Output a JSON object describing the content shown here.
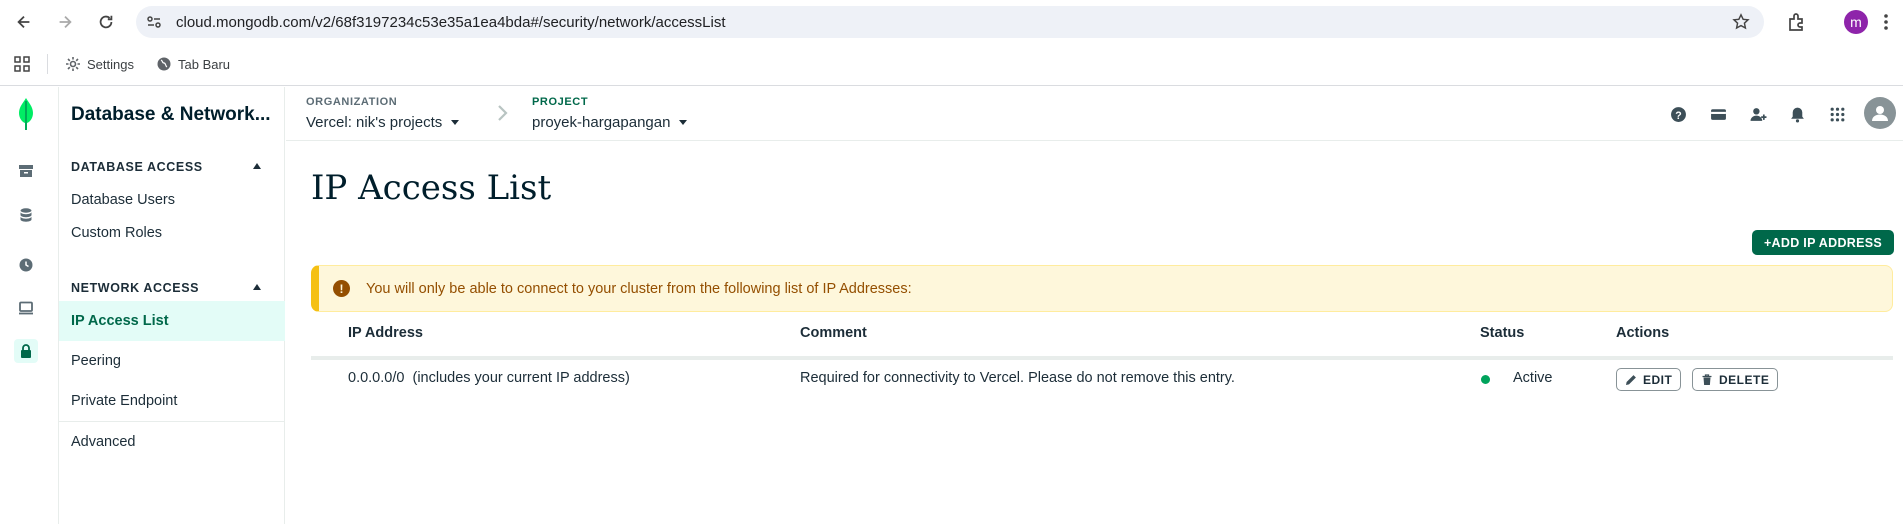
{
  "browser": {
    "url": "cloud.mongodb.com/v2/68f3197234c53e35a1ea4bda#/security/network/accessList",
    "profile_initial": "m"
  },
  "bookmarks": [
    {
      "label": "Settings",
      "icon": "gear-icon"
    },
    {
      "label": "Tab Baru",
      "icon": "globe-icon"
    }
  ],
  "sidebar": {
    "title": "Database & Network...",
    "sections": [
      {
        "header": "DATABASE ACCESS",
        "items": [
          "Database Users",
          "Custom Roles"
        ]
      },
      {
        "header": "NETWORK ACCESS",
        "items": [
          "IP Access List",
          "Peering",
          "Private Endpoint"
        ]
      }
    ],
    "footer_item": "Advanced",
    "active_item": "IP Access List"
  },
  "header": {
    "organization_label": "ORGANIZATION",
    "organization_value": "Vercel: nik's projects",
    "project_label": "PROJECT",
    "project_value": "proyek-hargapangan"
  },
  "main": {
    "title": "IP Access List",
    "add_button": "+ADD IP ADDRESS",
    "banner_text": "You will only be able to connect to your cluster from the following list of IP Addresses:",
    "columns": [
      "IP Address",
      "Comment",
      "Status",
      "Actions"
    ],
    "rows": [
      {
        "ip": "0.0.0.0/0  (includes your current IP address)",
        "comment": "Required for connectivity to Vercel. Please do not remove this entry.",
        "status": "Active",
        "edit": "EDIT",
        "delete": "DELETE"
      }
    ]
  },
  "colors": {
    "brand_green": "#00684a",
    "active_bg": "#e3fcf7",
    "banner_bg": "#fef7db",
    "banner_text": "#944f01",
    "status_active": "#00a35c"
  }
}
